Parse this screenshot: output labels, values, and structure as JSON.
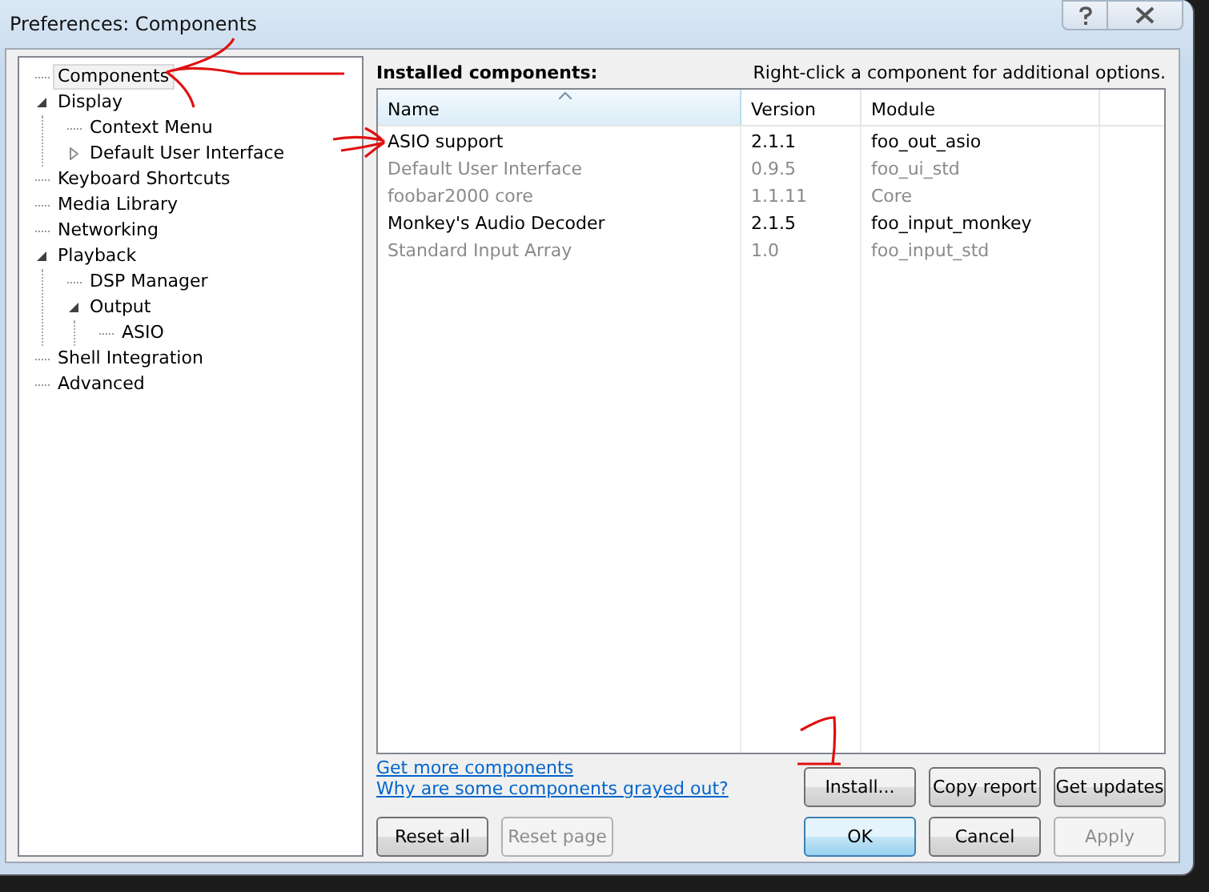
{
  "window": {
    "title": "Preferences: Components"
  },
  "tree": [
    {
      "label": "Components",
      "selected": true
    },
    {
      "label": "Display",
      "selected": false,
      "expanded": true,
      "children": [
        {
          "label": "Context Menu",
          "selected": false
        },
        {
          "label": "Default User Interface",
          "selected": false,
          "expanded": false
        }
      ]
    },
    {
      "label": "Keyboard Shortcuts",
      "selected": false
    },
    {
      "label": "Media Library",
      "selected": false
    },
    {
      "label": "Networking",
      "selected": false
    },
    {
      "label": "Playback",
      "selected": false,
      "expanded": true,
      "children": [
        {
          "label": "DSP Manager",
          "selected": false
        },
        {
          "label": "Output",
          "selected": false,
          "expanded": true,
          "children": [
            {
              "label": "ASIO",
              "selected": false
            }
          ]
        }
      ]
    },
    {
      "label": "Shell Integration",
      "selected": false
    },
    {
      "label": "Advanced",
      "selected": false
    }
  ],
  "panel": {
    "heading": "Installed components:",
    "hint": "Right-click a component for additional options."
  },
  "table": {
    "columns": [
      {
        "label": "Name",
        "sorted": true
      },
      {
        "label": "Version",
        "sorted": false
      },
      {
        "label": "Module",
        "sorted": false
      }
    ],
    "rows": [
      {
        "cells": [
          "ASIO support",
          "2.1.1",
          "foo_out_asio"
        ],
        "disabled": false
      },
      {
        "cells": [
          "Default User Interface",
          "0.9.5",
          "foo_ui_std"
        ],
        "disabled": true
      },
      {
        "cells": [
          "foobar2000 core",
          "1.1.11",
          "Core"
        ],
        "disabled": true
      },
      {
        "cells": [
          "Monkey's Audio Decoder",
          "2.1.5",
          "foo_input_monkey"
        ],
        "disabled": false
      },
      {
        "cells": [
          "Standard Input Array",
          "1.0",
          "foo_input_std"
        ],
        "disabled": true
      }
    ]
  },
  "links": [
    "Get more components",
    "Why are some components grayed out?"
  ],
  "component_buttons": [
    {
      "label": "Install...",
      "disabled": false
    },
    {
      "label": "Copy report",
      "disabled": false
    },
    {
      "label": "Get updates",
      "disabled": false
    }
  ],
  "page_buttons": [
    {
      "label": "Reset all",
      "disabled": false
    },
    {
      "label": "Reset page",
      "disabled": true
    }
  ],
  "dialog_buttons": [
    {
      "label": "OK",
      "disabled": false,
      "default": true
    },
    {
      "label": "Cancel",
      "disabled": false,
      "default": false
    },
    {
      "label": "Apply",
      "disabled": true,
      "default": false
    }
  ]
}
